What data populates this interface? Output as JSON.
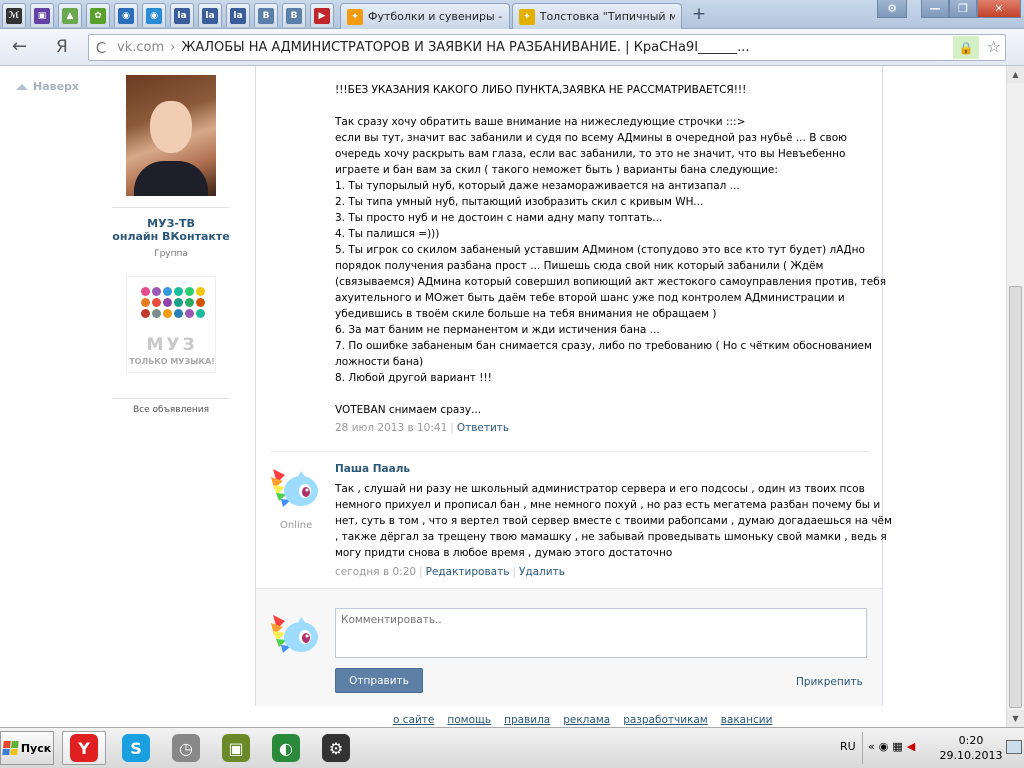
{
  "browser": {
    "pinned_tabs": [
      {
        "icon": "yandex-music-icon",
        "color": "#333333",
        "glyph": "ℳ"
      },
      {
        "icon": "twitch-icon",
        "color": "#6441a5",
        "glyph": "▣"
      },
      {
        "icon": "photo-icon",
        "color": "#6aa84f",
        "glyph": "▲"
      },
      {
        "icon": "leaf-icon",
        "color": "#5aa02c",
        "glyph": "✿"
      },
      {
        "icon": "globe-icon",
        "color": "#2a6ebb",
        "glyph": "◉"
      },
      {
        "icon": "globe-icon",
        "color": "#2a8bd5",
        "glyph": "◉"
      },
      {
        "icon": "lastfm-icon",
        "color": "#3b5d99",
        "glyph": "la"
      },
      {
        "icon": "lastfm-icon",
        "color": "#3b5d99",
        "glyph": "la"
      },
      {
        "icon": "lastfm-icon",
        "color": "#3b5d99",
        "glyph": "la"
      },
      {
        "icon": "vk-icon",
        "color": "#5b7fa6",
        "glyph": "B"
      },
      {
        "icon": "vk-icon",
        "color": "#5b7fa6",
        "glyph": "B"
      },
      {
        "icon": "media-icon",
        "color": "#c0272d",
        "glyph": "▶"
      }
    ],
    "tabs": [
      {
        "title": "Футболки и сувениры -",
        "icon_color": "#f39c12"
      },
      {
        "title": "Толстовка \"Типичный м",
        "icon_color": "#e2b100"
      }
    ],
    "new_tab": "+",
    "window_controls": {
      "settings": "⚙",
      "minimize": "—",
      "maximize": "❐",
      "close": "✕"
    },
    "back": "←",
    "yandex": "Я",
    "reload": "C",
    "url_domain": "vk.com",
    "url_separator": "›",
    "url_title": "ЖАЛОБЫ НА АДМИНИСТРАТОРОВ И ЗАЯВКИ НА РАЗБАНИВАНИЕ. | КраСНа9I______...",
    "lock": "🔒",
    "star": "☆"
  },
  "sidebar": {
    "back_to_top": "Наверх"
  },
  "left_column": {
    "group_name": "МУЗ-ТВ\nонлайн ВКонтакте",
    "group_type": "Группа",
    "ad_word": "МУЗ",
    "ad_tagline": "ТОЛЬКО МУЗЫКА!",
    "ads_link": "Все объявления"
  },
  "post": {
    "lines": [
      "",
      "!!!БЕЗ УКАЗАНИЯ КАКОГО ЛИБО ПУНКТА,ЗАЯВКА НЕ РАССМАТРИВАЕТСЯ!!!",
      "",
      "Так сразу хочу обратить ваше внимание на нижеследующие строчки :::>",
      "если вы тут, значит вас забанили и судя по всему АДмины в очередной раз нубьё ... В свою",
      "очередь хочу раскрыть вам глаза, если вас забанили, то это не значит, что вы Невъебенно",
      "играете и бан вам за скил ( такого неможет быть ) варианты бана следующие:",
      "1. Ты тупорылый нуб, который даже незамораживается на антизапал ...",
      "2. Ты типа умный нуб, пытающий изобразить скил с кривым WH...",
      "3. Ты просто нуб и не достоин с нами адну мапу топтать...",
      "4. Ты палишся =)))",
      "5. Ты игрок со скилом забаненый уставшим АДмином (стопудово это все кто тут будет) лАДно",
      "порядок получения разбана прост ... Пишешь сюда свой ник который забанили ( Ждём",
      "(связываемся) АДмина который совершил вопиющий акт жестокого самоуправления против, тебя",
      "ахуительного и МОжет быть даём тебе второй шанс уже под контролем АДминистрации и",
      "убедившись в твоём скиле больше на тебя внимания не обращаем )",
      "6. За мат баним не перманентом и жди истичения бана ...",
      "7. По ошибке забаненым бан снимается сразу, либо по требованию ( Но с чётким обоснованием",
      "ложности бана)",
      "8. Любой другой вариант !!!",
      "",
      "VOTEBAN снимаем сразу..."
    ],
    "date": "28 июл 2013 в 10:41",
    "reply_link": "Ответить"
  },
  "comment": {
    "author": "Паша Пааль",
    "status": "Online",
    "lines": [
      "Так , слушай ни разу не школьный администратор сервера и его подсосы , один из твоих псов",
      "немного прихуел и прописал бан , мне немного похуй , но раз есть мегатема разбан почему бы и",
      "нет, суть в том , что я вертел твой сервер вместе с твоими рабопсами , думаю догадаешься на чём",
      ", также дёргал за трещену твою мамашку , не забывай проведывать шмоньку свой мамки , ведь я",
      "могу придти снова в любое время , думаю этого достаточно"
    ],
    "date": "сегодня в 0:20",
    "edit_link": "Редактировать",
    "delete_link": "Удалить"
  },
  "reply_box": {
    "placeholder": "Комментировать..",
    "send_label": "Отправить",
    "attach_label": "Прикрепить"
  },
  "footer": [
    "о сайте",
    "помощь",
    "правила",
    "реклама",
    "разработчикам",
    "вакансии"
  ],
  "taskbar": {
    "start_label": "Пуск",
    "apps": [
      {
        "icon": "yandex-browser-icon",
        "glyph": "Y",
        "color": "#e02020",
        "active": true
      },
      {
        "icon": "skype-icon",
        "glyph": "S",
        "color": "#1aa0e0",
        "active": false
      },
      {
        "icon": "clock-app-icon",
        "glyph": "◷",
        "color": "#888888",
        "active": false
      },
      {
        "icon": "game-launcher-icon",
        "glyph": "▣",
        "color": "#6a8a2a",
        "active": false
      },
      {
        "icon": "headset-icon",
        "glyph": "◐",
        "color": "#2a8a3a",
        "active": false
      },
      {
        "icon": "steam-icon",
        "glyph": "⚙",
        "color": "#333333",
        "active": false
      }
    ],
    "language": "RU",
    "time": "0:20",
    "date": "29.10.2013"
  }
}
